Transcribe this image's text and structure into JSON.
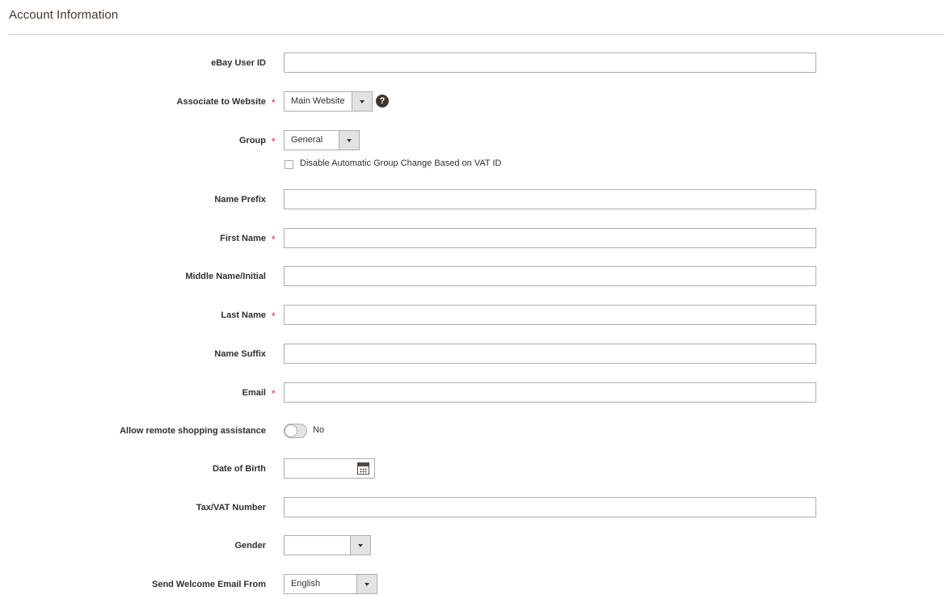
{
  "section": {
    "title": "Account Information"
  },
  "fields": {
    "ebay_user_id": {
      "label": "eBay User ID",
      "value": ""
    },
    "website": {
      "label": "Associate to Website",
      "required": "*",
      "value": "Main Website",
      "help": "?"
    },
    "group": {
      "label": "Group",
      "required": "*",
      "value": "General",
      "vat_checkbox_label": "Disable Automatic Group Change Based on VAT ID"
    },
    "name_prefix": {
      "label": "Name Prefix",
      "value": ""
    },
    "first_name": {
      "label": "First Name",
      "required": "*",
      "value": ""
    },
    "middle_name": {
      "label": "Middle Name/Initial",
      "value": ""
    },
    "last_name": {
      "label": "Last Name",
      "required": "*",
      "value": ""
    },
    "name_suffix": {
      "label": "Name Suffix",
      "value": ""
    },
    "email": {
      "label": "Email",
      "required": "*",
      "value": ""
    },
    "remote_assistance": {
      "label": "Allow remote shopping assistance",
      "state": "No"
    },
    "dob": {
      "label": "Date of Birth",
      "value": ""
    },
    "taxvat": {
      "label": "Tax/VAT Number",
      "value": ""
    },
    "gender": {
      "label": "Gender",
      "value": ""
    },
    "welcome_email": {
      "label": "Send Welcome Email From",
      "value": "English"
    }
  },
  "icons": {
    "dropdown": "chevron-down-icon",
    "help": "question-icon",
    "calendar": "calendar-icon"
  },
  "colors": {
    "required": "#e22626",
    "border": "#adadad",
    "icon_dark": "#41362f"
  }
}
